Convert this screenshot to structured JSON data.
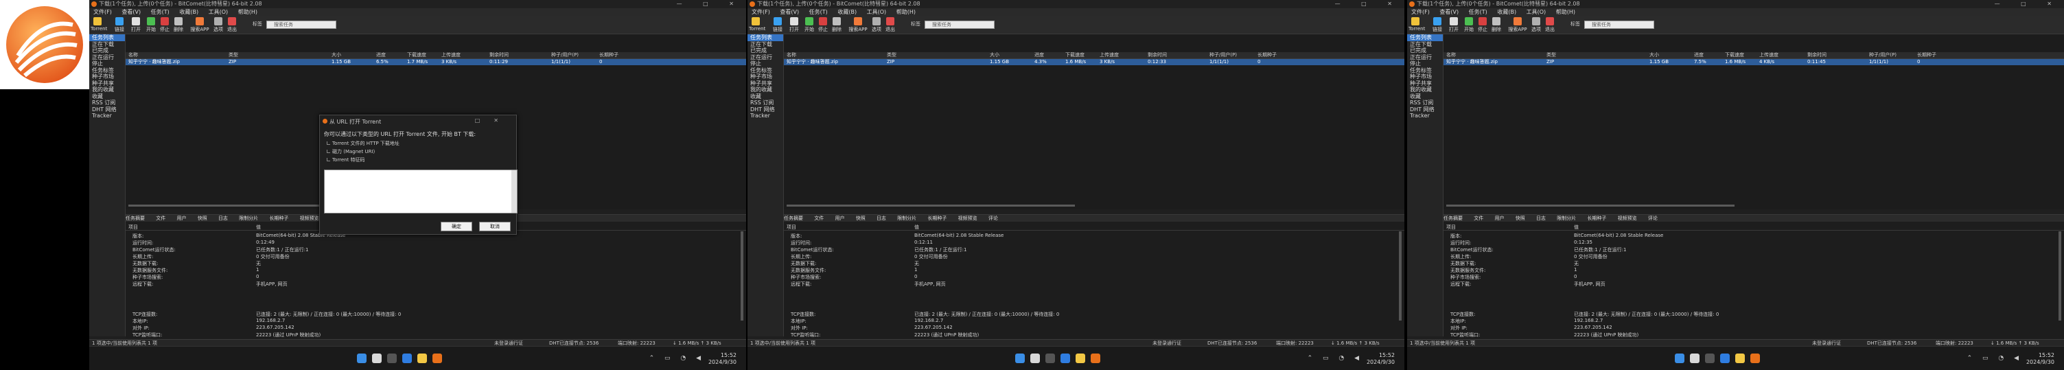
{
  "window": {
    "title": "下载(1个任务), 上传(0个任务) - BitComet(比特彗星) 64-bit 2.08",
    "controls": "—  □  ✕"
  },
  "menu": [
    "文件(F)",
    "查看(V)",
    "任务(T)",
    "收藏(B)",
    "工具(O)",
    "帮助(H)"
  ],
  "toolbar": {
    "buttons": [
      "Torrent",
      "链接",
      "打开",
      "开始",
      "停止",
      "删除",
      "搜索APP",
      "选项",
      "退出"
    ],
    "search_placeholder": "搜索任务",
    "search_tag": "标签"
  },
  "sidebar": {
    "items": [
      "任务列表",
      "正在下载",
      "已完成",
      "正在运行",
      "停止",
      "任务标签",
      "种子市场",
      "种子共享",
      "我的收藏",
      "收藏",
      "RSS 订阅",
      "DHT 网络",
      "Tracker"
    ]
  },
  "list": {
    "columns": [
      "名称",
      "类型",
      "大小",
      "进度",
      "下载速度",
      "上传速度",
      "剩余时间",
      "种子/用户(P)",
      "长期种子"
    ],
    "task": {
      "name": "知乎宁宁 · 趣味答题.zip",
      "type": "ZIP",
      "size": "1.15 GB"
    }
  },
  "screens": [
    {
      "progress": "6.5%",
      "down": "1.7 MB/s",
      "up": "3 KB/s",
      "eta": "0:11:29",
      "peers": "1/1(1/1)",
      "seed": "0",
      "uptime": "0:12:49",
      "pieces": "0 交付可用备份"
    },
    {
      "progress": "4.3%",
      "down": "1.6 MB/s",
      "up": "3 KB/s",
      "eta": "0:12:33",
      "peers": "1/1(1/1)",
      "seed": "0",
      "uptime": "0:12:11",
      "pieces": "0 交付可用备份"
    },
    {
      "progress": "7.5%",
      "down": "1.6 MB/s",
      "up": "4 KB/s",
      "eta": "0:11:45",
      "peers": "1/1(1/1)",
      "seed": "0",
      "uptime": "0:12:35",
      "pieces": "0 交付可用备份"
    }
  ],
  "detail": {
    "tabs": [
      "任务摘要",
      "文件",
      "用户",
      "快照",
      "日志",
      "限制分片",
      "长期种子",
      "视频预览",
      "评论"
    ],
    "head": [
      "项目",
      "值"
    ],
    "rows": [
      {
        "k": "版本:",
        "v": "BitComet(64-bit) 2.08 Stable Release"
      },
      {
        "k": "运行时间:",
        "v": ""
      },
      {
        "k": "BitComet运行状态:",
        "v": "已任务数:1 / 正在运行:1"
      },
      {
        "k": "长期上传:",
        "v": ""
      },
      {
        "k": "无数据下载:",
        "v": "无"
      },
      {
        "k": "无数据服务文件:",
        "v": "1"
      },
      {
        "k": "种子市场搜索:",
        "v": "0"
      },
      {
        "k": "远程下载:",
        "v": "手机APP, 网页"
      }
    ],
    "net_rows": [
      {
        "k": "TCP连接数:",
        "v": "已连接: 2 (最大: 无限制) / 正在连接: 0 (最大:10000) / 等待连接: 0"
      },
      {
        "k": "本地IP:",
        "v": "192.168.2.7"
      },
      {
        "k": "对外 IP:",
        "v": "223.67.205.142"
      },
      {
        "k": "TCP监听端口:",
        "v": "22223 (通过 UPnP 映射成功)"
      }
    ]
  },
  "statusbar": {
    "left": "1 项选中/当前使用列表共 1 项",
    "login": "未登录通行证",
    "dht": "DHT已连接节点: 2536",
    "port": "端口映射: 22223",
    "speed": "↓ 1.6 MB/s  ↑ 3 KB/s"
  },
  "dialog": {
    "title": "从 URL 打开 Torrent",
    "description": "你可以通过以下类型的 URL 打开 Torrent 文件, 开始 BT 下载:",
    "options": [
      "Torrent 文件的 HTTP 下载地址",
      "磁力 (Magnet URI)",
      "Torrent 特征码"
    ],
    "ok": "确定",
    "cancel": "取消"
  },
  "taskbar": {
    "time": "15:52",
    "date": "2024/9/30"
  },
  "colors": {
    "accent": "#3574c4",
    "logo_orange": "#e8701a",
    "dark_bg": "#1f1f1f"
  }
}
